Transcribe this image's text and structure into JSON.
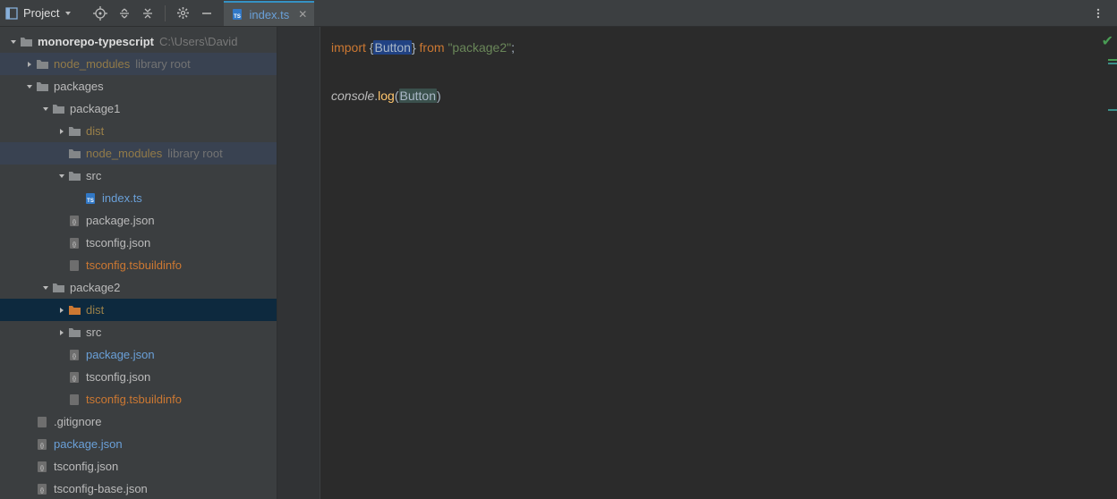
{
  "toolbar": {
    "project_label": "Project"
  },
  "tab": {
    "filename": "index.ts"
  },
  "tree": {
    "root": {
      "name": "monorepo-typescript",
      "path": "C:\\Users\\David"
    },
    "nm1": {
      "name": "node_modules",
      "hint": "library root"
    },
    "packages": "packages",
    "pkg1": "package1",
    "pkg1_dist": "dist",
    "pkg1_nm": {
      "name": "node_modules",
      "hint": "library root"
    },
    "pkg1_src": "src",
    "pkg1_index": "index.ts",
    "pkg1_pj": "package.json",
    "pkg1_tsc": "tsconfig.json",
    "pkg1_tsb": "tsconfig.tsbuildinfo",
    "pkg2": "package2",
    "pkg2_dist": "dist",
    "pkg2_src": "src",
    "pkg2_pj": "package.json",
    "pkg2_tsc": "tsconfig.json",
    "pkg2_tsb": "tsconfig.tsbuildinfo",
    "gitignore": ".gitignore",
    "root_pj": "package.json",
    "root_tsc": "tsconfig.json",
    "root_tscb": "tsconfig-base.json"
  },
  "code": {
    "l1": {
      "kw": "import ",
      "br_open": "{",
      "id": "Button",
      "br_close": "}",
      "from": " from ",
      "str": "\"package2\"",
      "semi": ";"
    },
    "l3": {
      "obj": "console",
      "dot": ".",
      "method": "log",
      "paren_open": "(",
      "arg": "Button",
      "paren_close": ")"
    }
  }
}
